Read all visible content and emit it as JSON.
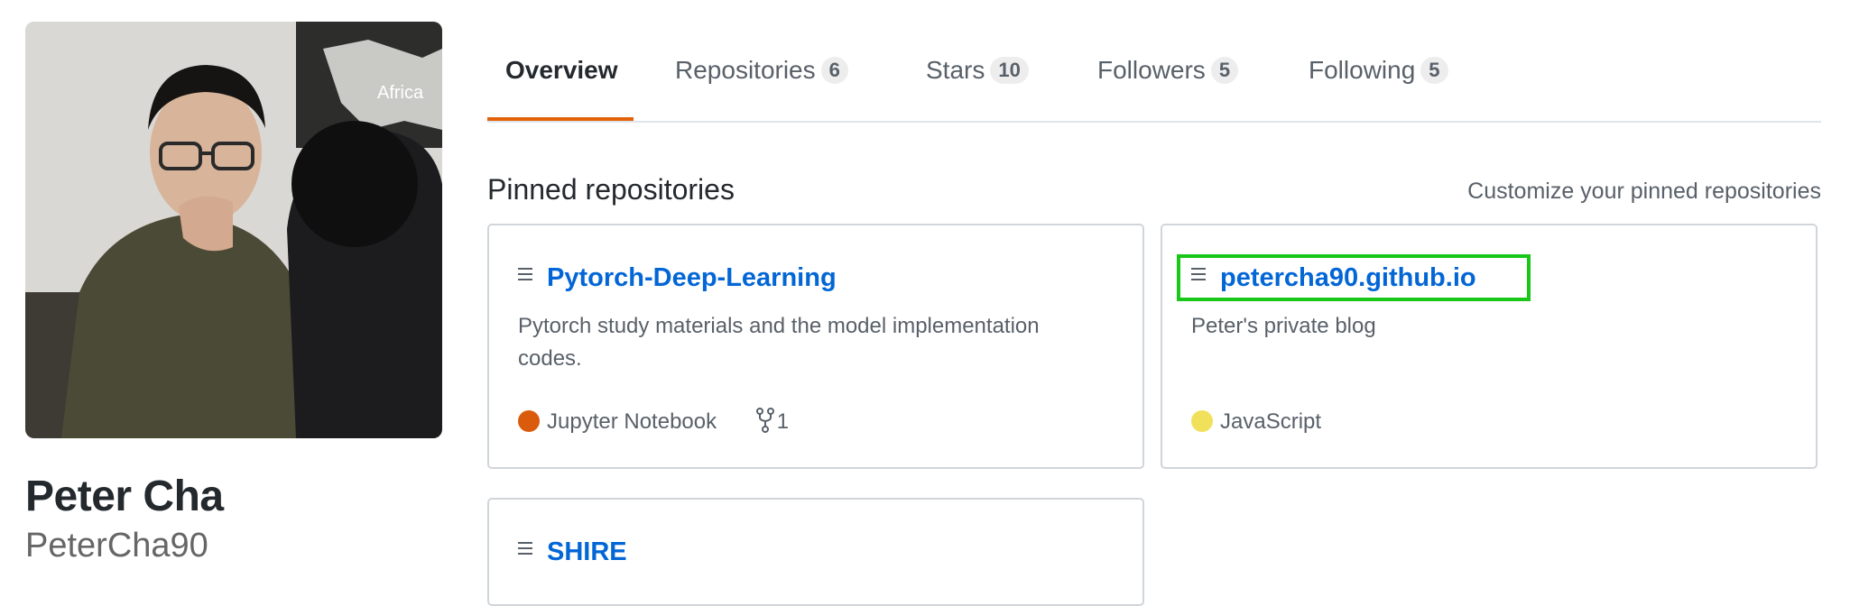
{
  "profile": {
    "name": "Peter Cha",
    "login": "PeterCha90"
  },
  "nav": {
    "tabs": [
      {
        "label": "Overview",
        "selected": true
      },
      {
        "label": "Repositories",
        "count": "6"
      },
      {
        "label": "Stars",
        "count": "10"
      },
      {
        "label": "Followers",
        "count": "5"
      },
      {
        "label": "Following",
        "count": "5"
      }
    ]
  },
  "pinned": {
    "title": "Pinned repositories",
    "customize_label": "Customize your pinned repositories",
    "repos": [
      {
        "name": "Pytorch-Deep-Learning",
        "description": "Pytorch study materials and the model implementation codes.",
        "language": "Jupyter Notebook",
        "language_color": "#DA5B0B",
        "forks": "1"
      },
      {
        "name": "petercha90.github.io",
        "description": "Peter's private blog",
        "language": "JavaScript",
        "language_color": "#F1E05A"
      },
      {
        "name": "SHIRE"
      }
    ]
  },
  "colors": {
    "accent_tab": "#E36209",
    "link": "#0366D6",
    "highlight": "#18C718"
  },
  "avatar_overlay_text": "Africa"
}
